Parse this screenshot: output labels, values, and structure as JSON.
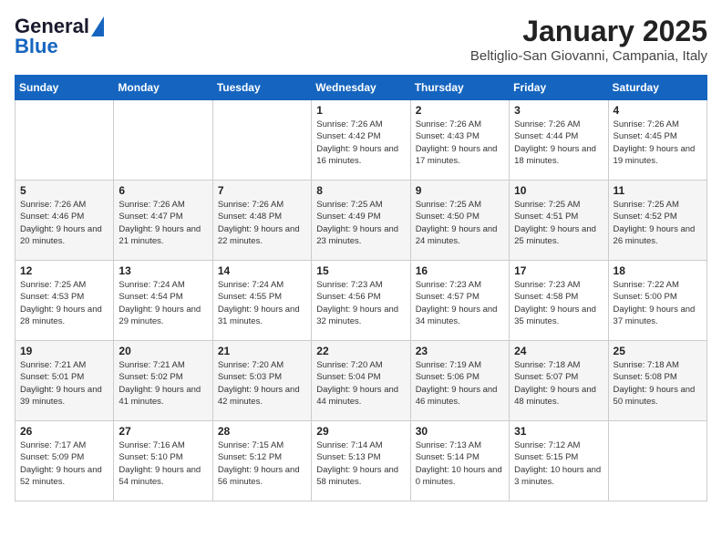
{
  "header": {
    "logo_general": "General",
    "logo_blue": "Blue",
    "month": "January 2025",
    "location": "Beltiglio-San Giovanni, Campania, Italy"
  },
  "weekdays": [
    "Sunday",
    "Monday",
    "Tuesday",
    "Wednesday",
    "Thursday",
    "Friday",
    "Saturday"
  ],
  "weeks": [
    [
      {
        "day": "",
        "text": ""
      },
      {
        "day": "",
        "text": ""
      },
      {
        "day": "",
        "text": ""
      },
      {
        "day": "1",
        "text": "Sunrise: 7:26 AM\nSunset: 4:42 PM\nDaylight: 9 hours and 16 minutes."
      },
      {
        "day": "2",
        "text": "Sunrise: 7:26 AM\nSunset: 4:43 PM\nDaylight: 9 hours and 17 minutes."
      },
      {
        "day": "3",
        "text": "Sunrise: 7:26 AM\nSunset: 4:44 PM\nDaylight: 9 hours and 18 minutes."
      },
      {
        "day": "4",
        "text": "Sunrise: 7:26 AM\nSunset: 4:45 PM\nDaylight: 9 hours and 19 minutes."
      }
    ],
    [
      {
        "day": "5",
        "text": "Sunrise: 7:26 AM\nSunset: 4:46 PM\nDaylight: 9 hours and 20 minutes."
      },
      {
        "day": "6",
        "text": "Sunrise: 7:26 AM\nSunset: 4:47 PM\nDaylight: 9 hours and 21 minutes."
      },
      {
        "day": "7",
        "text": "Sunrise: 7:26 AM\nSunset: 4:48 PM\nDaylight: 9 hours and 22 minutes."
      },
      {
        "day": "8",
        "text": "Sunrise: 7:25 AM\nSunset: 4:49 PM\nDaylight: 9 hours and 23 minutes."
      },
      {
        "day": "9",
        "text": "Sunrise: 7:25 AM\nSunset: 4:50 PM\nDaylight: 9 hours and 24 minutes."
      },
      {
        "day": "10",
        "text": "Sunrise: 7:25 AM\nSunset: 4:51 PM\nDaylight: 9 hours and 25 minutes."
      },
      {
        "day": "11",
        "text": "Sunrise: 7:25 AM\nSunset: 4:52 PM\nDaylight: 9 hours and 26 minutes."
      }
    ],
    [
      {
        "day": "12",
        "text": "Sunrise: 7:25 AM\nSunset: 4:53 PM\nDaylight: 9 hours and 28 minutes."
      },
      {
        "day": "13",
        "text": "Sunrise: 7:24 AM\nSunset: 4:54 PM\nDaylight: 9 hours and 29 minutes."
      },
      {
        "day": "14",
        "text": "Sunrise: 7:24 AM\nSunset: 4:55 PM\nDaylight: 9 hours and 31 minutes."
      },
      {
        "day": "15",
        "text": "Sunrise: 7:23 AM\nSunset: 4:56 PM\nDaylight: 9 hours and 32 minutes."
      },
      {
        "day": "16",
        "text": "Sunrise: 7:23 AM\nSunset: 4:57 PM\nDaylight: 9 hours and 34 minutes."
      },
      {
        "day": "17",
        "text": "Sunrise: 7:23 AM\nSunset: 4:58 PM\nDaylight: 9 hours and 35 minutes."
      },
      {
        "day": "18",
        "text": "Sunrise: 7:22 AM\nSunset: 5:00 PM\nDaylight: 9 hours and 37 minutes."
      }
    ],
    [
      {
        "day": "19",
        "text": "Sunrise: 7:21 AM\nSunset: 5:01 PM\nDaylight: 9 hours and 39 minutes."
      },
      {
        "day": "20",
        "text": "Sunrise: 7:21 AM\nSunset: 5:02 PM\nDaylight: 9 hours and 41 minutes."
      },
      {
        "day": "21",
        "text": "Sunrise: 7:20 AM\nSunset: 5:03 PM\nDaylight: 9 hours and 42 minutes."
      },
      {
        "day": "22",
        "text": "Sunrise: 7:20 AM\nSunset: 5:04 PM\nDaylight: 9 hours and 44 minutes."
      },
      {
        "day": "23",
        "text": "Sunrise: 7:19 AM\nSunset: 5:06 PM\nDaylight: 9 hours and 46 minutes."
      },
      {
        "day": "24",
        "text": "Sunrise: 7:18 AM\nSunset: 5:07 PM\nDaylight: 9 hours and 48 minutes."
      },
      {
        "day": "25",
        "text": "Sunrise: 7:18 AM\nSunset: 5:08 PM\nDaylight: 9 hours and 50 minutes."
      }
    ],
    [
      {
        "day": "26",
        "text": "Sunrise: 7:17 AM\nSunset: 5:09 PM\nDaylight: 9 hours and 52 minutes."
      },
      {
        "day": "27",
        "text": "Sunrise: 7:16 AM\nSunset: 5:10 PM\nDaylight: 9 hours and 54 minutes."
      },
      {
        "day": "28",
        "text": "Sunrise: 7:15 AM\nSunset: 5:12 PM\nDaylight: 9 hours and 56 minutes."
      },
      {
        "day": "29",
        "text": "Sunrise: 7:14 AM\nSunset: 5:13 PM\nDaylight: 9 hours and 58 minutes."
      },
      {
        "day": "30",
        "text": "Sunrise: 7:13 AM\nSunset: 5:14 PM\nDaylight: 10 hours and 0 minutes."
      },
      {
        "day": "31",
        "text": "Sunrise: 7:12 AM\nSunset: 5:15 PM\nDaylight: 10 hours and 3 minutes."
      },
      {
        "day": "",
        "text": ""
      }
    ]
  ]
}
